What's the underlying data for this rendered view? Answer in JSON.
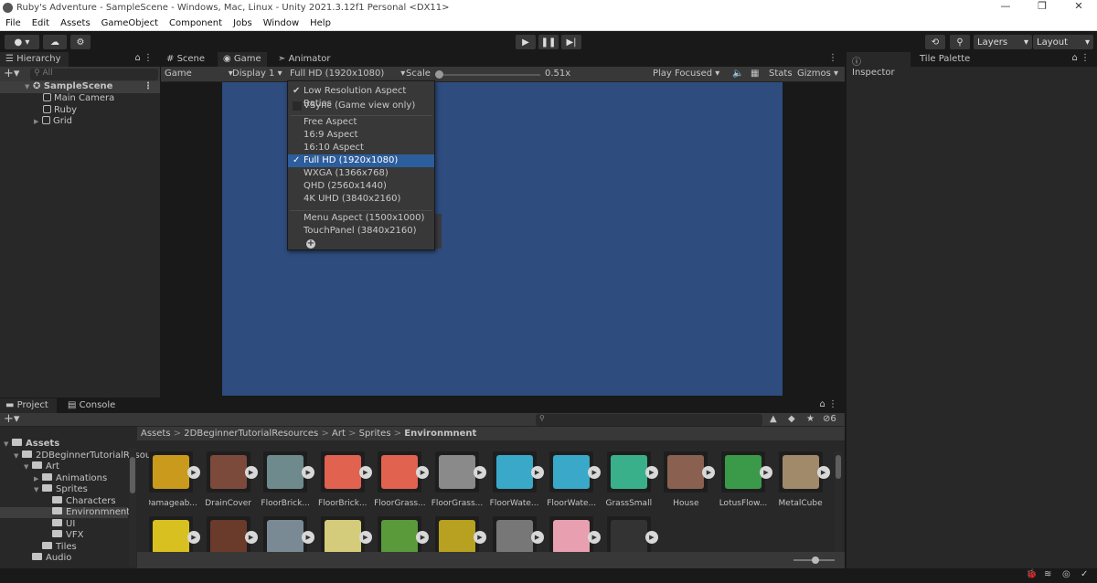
{
  "window": {
    "title": "Ruby's Adventure - SampleScene - Windows, Mac, Linux - Unity 2021.3.12f1 Personal <DX11>",
    "controls": [
      "—",
      "❐",
      "✕"
    ]
  },
  "menu": [
    "File",
    "Edit",
    "Assets",
    "GameObject",
    "Component",
    "Jobs",
    "Window",
    "Help"
  ],
  "toolbar": {
    "layers": "Layers",
    "layout": "Layout"
  },
  "hierarchy": {
    "tab": "Hierarchy",
    "search_placeholder": "All",
    "scene": "SampleScene",
    "items": [
      "Main Camera",
      "Ruby",
      "Grid"
    ]
  },
  "game": {
    "tabs": [
      "Scene",
      "Game",
      "Animator"
    ],
    "view_mode": "Game",
    "display": "Display 1",
    "resolution": "Full HD (1920x1080)",
    "scale_label": "Scale",
    "scale_value": "0.51x",
    "scale_fraction": 0.0,
    "play_mode": "Play Focused",
    "stats": "Stats",
    "gizmos": "Gizmos",
    "viewport_color": "#2e4c7d"
  },
  "resolution_menu": {
    "low_res": "Low Resolution Aspect Ratios",
    "low_res_checked": true,
    "vsync": "VSync (Game view only)",
    "vsync_checked": false,
    "group1": [
      "Free Aspect",
      "16:9 Aspect",
      "16:10 Aspect",
      "Full HD (1920x1080)",
      "WXGA (1366x768)",
      "QHD (2560x1440)",
      "4K UHD (3840x2160)"
    ],
    "selected": "Full HD (1920x1080)",
    "group2": [
      "Menu Aspect (1500x1000)",
      "TouchPanel (3840x2160)"
    ],
    "add": "+"
  },
  "inspector": {
    "tabs": [
      "Inspector",
      "Tile Palette"
    ]
  },
  "project": {
    "tabs": [
      "Project",
      "Console"
    ],
    "tree": [
      {
        "label": "Assets",
        "depth": 0,
        "open": true,
        "bold": true
      },
      {
        "label": "2DBeginnerTutorialResources",
        "depth": 1,
        "open": true
      },
      {
        "label": "Art",
        "depth": 2,
        "open": true
      },
      {
        "label": "Animations",
        "depth": 3,
        "open": false
      },
      {
        "label": "Sprites",
        "depth": 3,
        "open": true
      },
      {
        "label": "Characters",
        "depth": 4
      },
      {
        "label": "Environmnent",
        "depth": 4,
        "selected": true
      },
      {
        "label": "UI",
        "depth": 4
      },
      {
        "label": "VFX",
        "depth": 4
      },
      {
        "label": "Tiles",
        "depth": 3
      },
      {
        "label": "Audio",
        "depth": 2
      }
    ],
    "breadcrumb": [
      "Assets",
      "2DBeginnerTutorialResources",
      "Art",
      "Sprites",
      "Environmnent"
    ],
    "hidden_count": "6",
    "assets": [
      {
        "name": "Damageab...",
        "color": "#c99a1c"
      },
      {
        "name": "DrainCover",
        "color": "#7b4a3a"
      },
      {
        "name": "FloorBrick...",
        "color": "#6f8a8c"
      },
      {
        "name": "FloorBrick...",
        "color": "#e0624f"
      },
      {
        "name": "FloorGrass...",
        "color": "#e0624f"
      },
      {
        "name": "FloorGrass...",
        "color": "#8a8a8a"
      },
      {
        "name": "FloorWate...",
        "color": "#3aa8c8"
      },
      {
        "name": "FloorWate...",
        "color": "#3aa8c8"
      },
      {
        "name": "GrassSmall",
        "color": "#3ab08a"
      },
      {
        "name": "House",
        "color": "#8a6050"
      },
      {
        "name": "LotusFlow...",
        "color": "#3a9a4a"
      },
      {
        "name": "MetalCube",
        "color": "#a08a6a"
      }
    ],
    "assets_row2": [
      {
        "color": "#d8c020"
      },
      {
        "color": "#6a3a2a"
      },
      {
        "color": "#7a8a94"
      },
      {
        "color": "#d4cc7a"
      },
      {
        "color": "#5a9a3a"
      },
      {
        "color": "#b8a020"
      },
      {
        "color": "#777777"
      },
      {
        "color": "#e8a0b0"
      },
      {
        "color": "#333333"
      }
    ]
  }
}
